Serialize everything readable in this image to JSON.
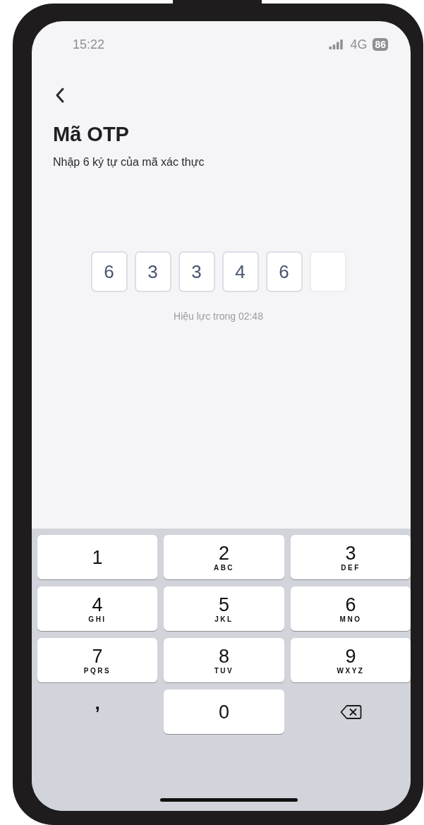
{
  "status_bar": {
    "time": "15:22",
    "network": "4G",
    "battery": "86"
  },
  "header": {
    "title": "Mã OTP",
    "subtitle": "Nhập 6 ký tự của mã xác thực"
  },
  "otp": {
    "digits": [
      {
        "value": "6",
        "filled": true
      },
      {
        "value": "3",
        "filled": true
      },
      {
        "value": "3",
        "filled": true
      },
      {
        "value": "4",
        "filled": true
      },
      {
        "value": "6",
        "filled": true
      },
      {
        "filled": false
      }
    ],
    "timer": "Hiệu lực trong 02:48"
  },
  "keypad": {
    "keys": [
      {
        "kind": "digit",
        "digit": "1"
      },
      {
        "kind": "digit",
        "digit": "2",
        "letters": "ABC"
      },
      {
        "kind": "digit",
        "digit": "3",
        "letters": "DEF"
      },
      {
        "kind": "digit",
        "digit": "4",
        "letters": "GHI"
      },
      {
        "kind": "digit",
        "digit": "5",
        "letters": "JKL"
      },
      {
        "kind": "digit",
        "digit": "6",
        "letters": "MNO"
      },
      {
        "kind": "digit",
        "digit": "7",
        "letters": "PQRS"
      },
      {
        "kind": "digit",
        "digit": "8",
        "letters": "TUV"
      },
      {
        "kind": "digit",
        "digit": "9",
        "letters": "WXYZ"
      },
      {
        "kind": "comma",
        "digit": ","
      },
      {
        "kind": "digit",
        "digit": "0"
      },
      {
        "kind": "delete"
      }
    ]
  }
}
